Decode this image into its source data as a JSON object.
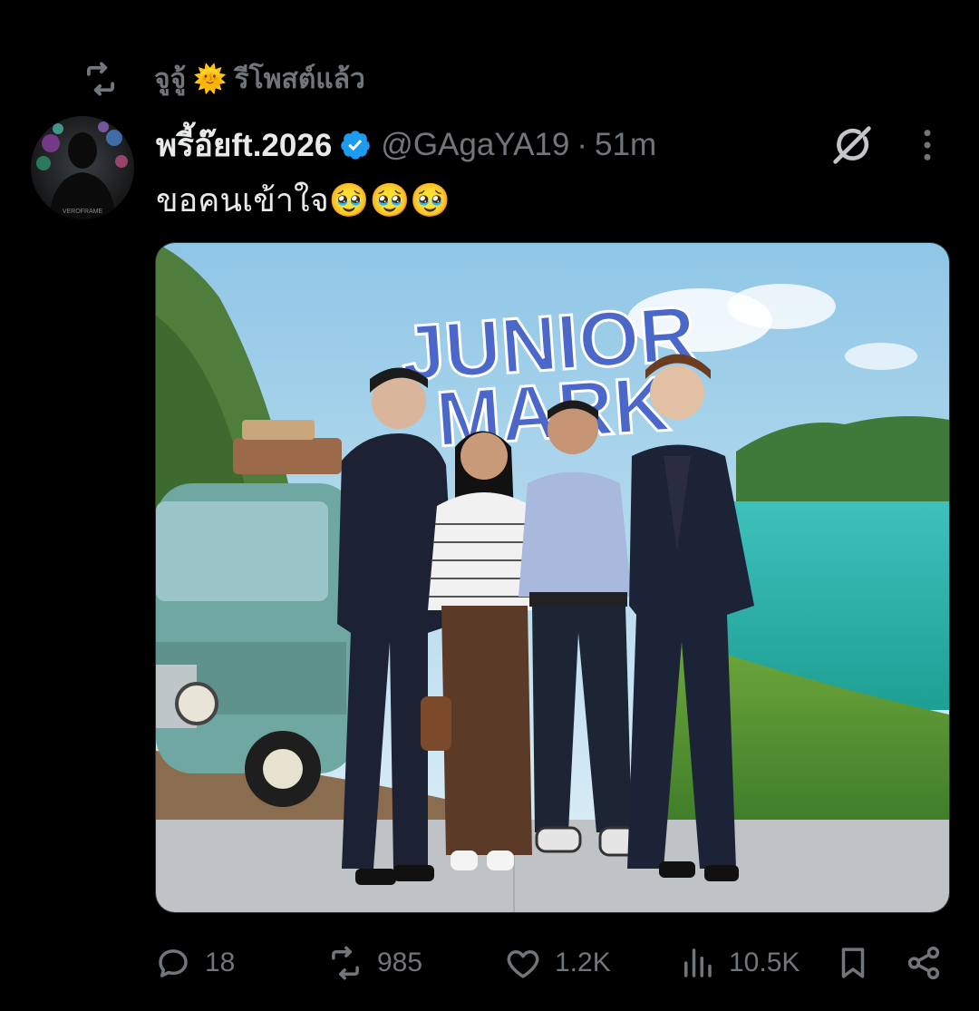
{
  "repost": {
    "user": "จูจู้",
    "emoji": "🌞",
    "label": "รีโพสต์แล้ว",
    "icon": "repost-icon"
  },
  "tweet": {
    "display_name": "พรี้อ๊ยft.2026",
    "handle": "@GAgaYA19",
    "separator": "·",
    "time": "51m",
    "text": "ขอคนเข้าใจ🥹🥹🥹",
    "avatar_label": "VEROFRAME",
    "verified_icon": "verified-badge-icon",
    "grok_icon": "grok-icon",
    "more_icon": "more-vertical-icon"
  },
  "media": {
    "sign_line1": "JUNIOR",
    "sign_line2": "MARK",
    "description_icon": "photo"
  },
  "actions": {
    "replies": "18",
    "reposts": "985",
    "likes": "1.2K",
    "views": "10.5K",
    "icons": [
      "reply-icon",
      "repost-icon",
      "like-icon",
      "views-icon",
      "bookmark-icon",
      "share-icon"
    ]
  },
  "colors": {
    "background": "#000000",
    "text": "#e7e9ea",
    "muted": "#71767b",
    "verified": "#1d9bf0"
  }
}
